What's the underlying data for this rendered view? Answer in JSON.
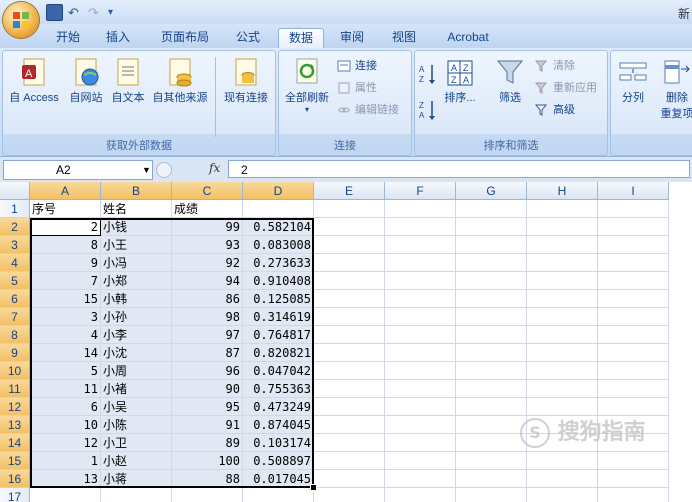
{
  "app_title": "新",
  "tabs": [
    "开始",
    "插入",
    "页面布局",
    "公式",
    "数据",
    "审阅",
    "视图",
    "Acrobat"
  ],
  "active_tab": "数据",
  "ribbon": {
    "get_external": {
      "label": "获取外部数据",
      "buttons": [
        "自 Access",
        "自网站",
        "自文本",
        "自其他来源",
        "现有连接"
      ]
    },
    "connections": {
      "label": "连接",
      "refresh": "全部刷新",
      "items": [
        "连接",
        "属性",
        "编辑链接"
      ]
    },
    "sort_filter": {
      "label": "排序和筛选",
      "sort": "排序...",
      "filter": "筛选",
      "items": [
        "清除",
        "重新应用",
        "高级"
      ]
    },
    "tools": {
      "buttons": [
        "分列",
        "删除",
        "重复项"
      ]
    }
  },
  "formula_bar": {
    "name_box": "A2",
    "fx": "fx",
    "value": "2"
  },
  "columns": [
    "A",
    "B",
    "C",
    "D",
    "E",
    "F",
    "G",
    "H",
    "I"
  ],
  "selected_columns": [
    "A",
    "B",
    "C",
    "D"
  ],
  "header_row": [
    "序号",
    "姓名",
    "成绩"
  ],
  "rows": [
    [
      "2",
      "小钱",
      "99",
      "0.582104"
    ],
    [
      "8",
      "小王",
      "93",
      "0.083008"
    ],
    [
      "9",
      "小冯",
      "92",
      "0.273633"
    ],
    [
      "7",
      "小郑",
      "94",
      "0.910408"
    ],
    [
      "15",
      "小韩",
      "86",
      "0.125085"
    ],
    [
      "3",
      "小孙",
      "98",
      "0.314619"
    ],
    [
      "4",
      "小李",
      "97",
      "0.764817"
    ],
    [
      "14",
      "小沈",
      "87",
      "0.820821"
    ],
    [
      "5",
      "小周",
      "96",
      "0.047042"
    ],
    [
      "11",
      "小褚",
      "90",
      "0.755363"
    ],
    [
      "6",
      "小吴",
      "95",
      "0.473249"
    ],
    [
      "10",
      "小陈",
      "91",
      "0.874045"
    ],
    [
      "12",
      "小卫",
      "89",
      "0.103174"
    ],
    [
      "1",
      "小赵",
      "100",
      "0.508897"
    ],
    [
      "13",
      "小蒋",
      "88",
      "0.017045"
    ]
  ],
  "row_numbers": [
    "1",
    "2",
    "3",
    "4",
    "5",
    "6",
    "7",
    "8",
    "9",
    "10",
    "11",
    "12",
    "13",
    "14",
    "15",
    "16",
    "17"
  ],
  "watermark": "搜狗指南"
}
